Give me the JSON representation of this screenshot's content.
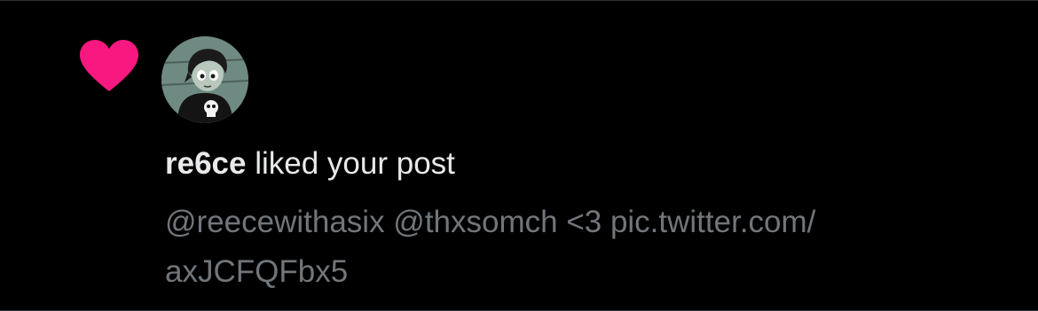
{
  "notification": {
    "type_icon": "heart-icon",
    "icon_color": "#f91880",
    "avatar_alt": "re6ce avatar",
    "username": "re6ce",
    "action_text": "liked your post",
    "preview_lines": [
      "@reecewithasix @thxsomch <3 pic.twitter.com/",
      "axJCFQFbx5"
    ]
  },
  "colors": {
    "background": "#000000",
    "primary_text": "#e7e9ea",
    "secondary_text": "#71767b",
    "divider": "#2f3336"
  }
}
